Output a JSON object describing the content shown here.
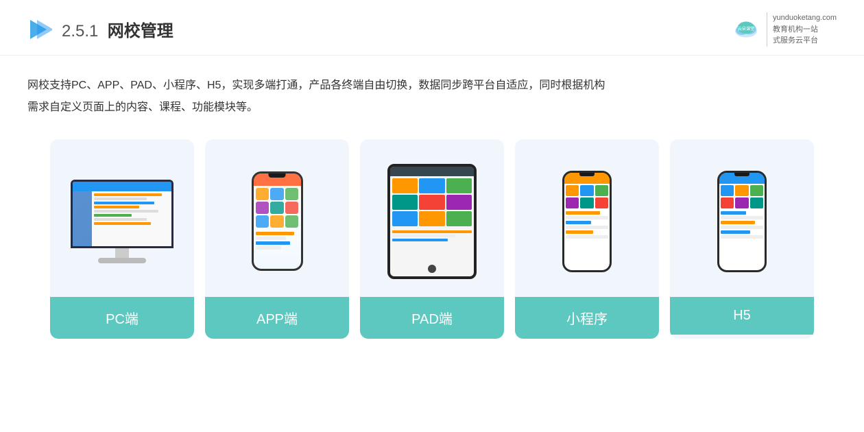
{
  "header": {
    "section_number": "2.5.1",
    "title": "网校管理",
    "brand_name": "云朵课堂",
    "brand_url": "yunduoketang.com",
    "brand_slogan_line1": "教育机构一站",
    "brand_slogan_line2": "式服务云平台"
  },
  "description": {
    "line1": "网校支持PC、APP、PAD、小程序、H5，实现多端打通，产品各终端自由切换，数据同步跨平台自适应，同时根据机构",
    "line2": "需求自定义页面上的内容、课程、功能模块等。"
  },
  "cards": [
    {
      "id": "pc",
      "label": "PC端"
    },
    {
      "id": "app",
      "label": "APP端"
    },
    {
      "id": "pad",
      "label": "PAD端"
    },
    {
      "id": "miniapp",
      "label": "小程序"
    },
    {
      "id": "h5",
      "label": "H5"
    }
  ],
  "colors": {
    "card_bg": "#eef5fb",
    "card_label_bg": "#5dc8c0",
    "card_label_text": "#ffffff"
  }
}
